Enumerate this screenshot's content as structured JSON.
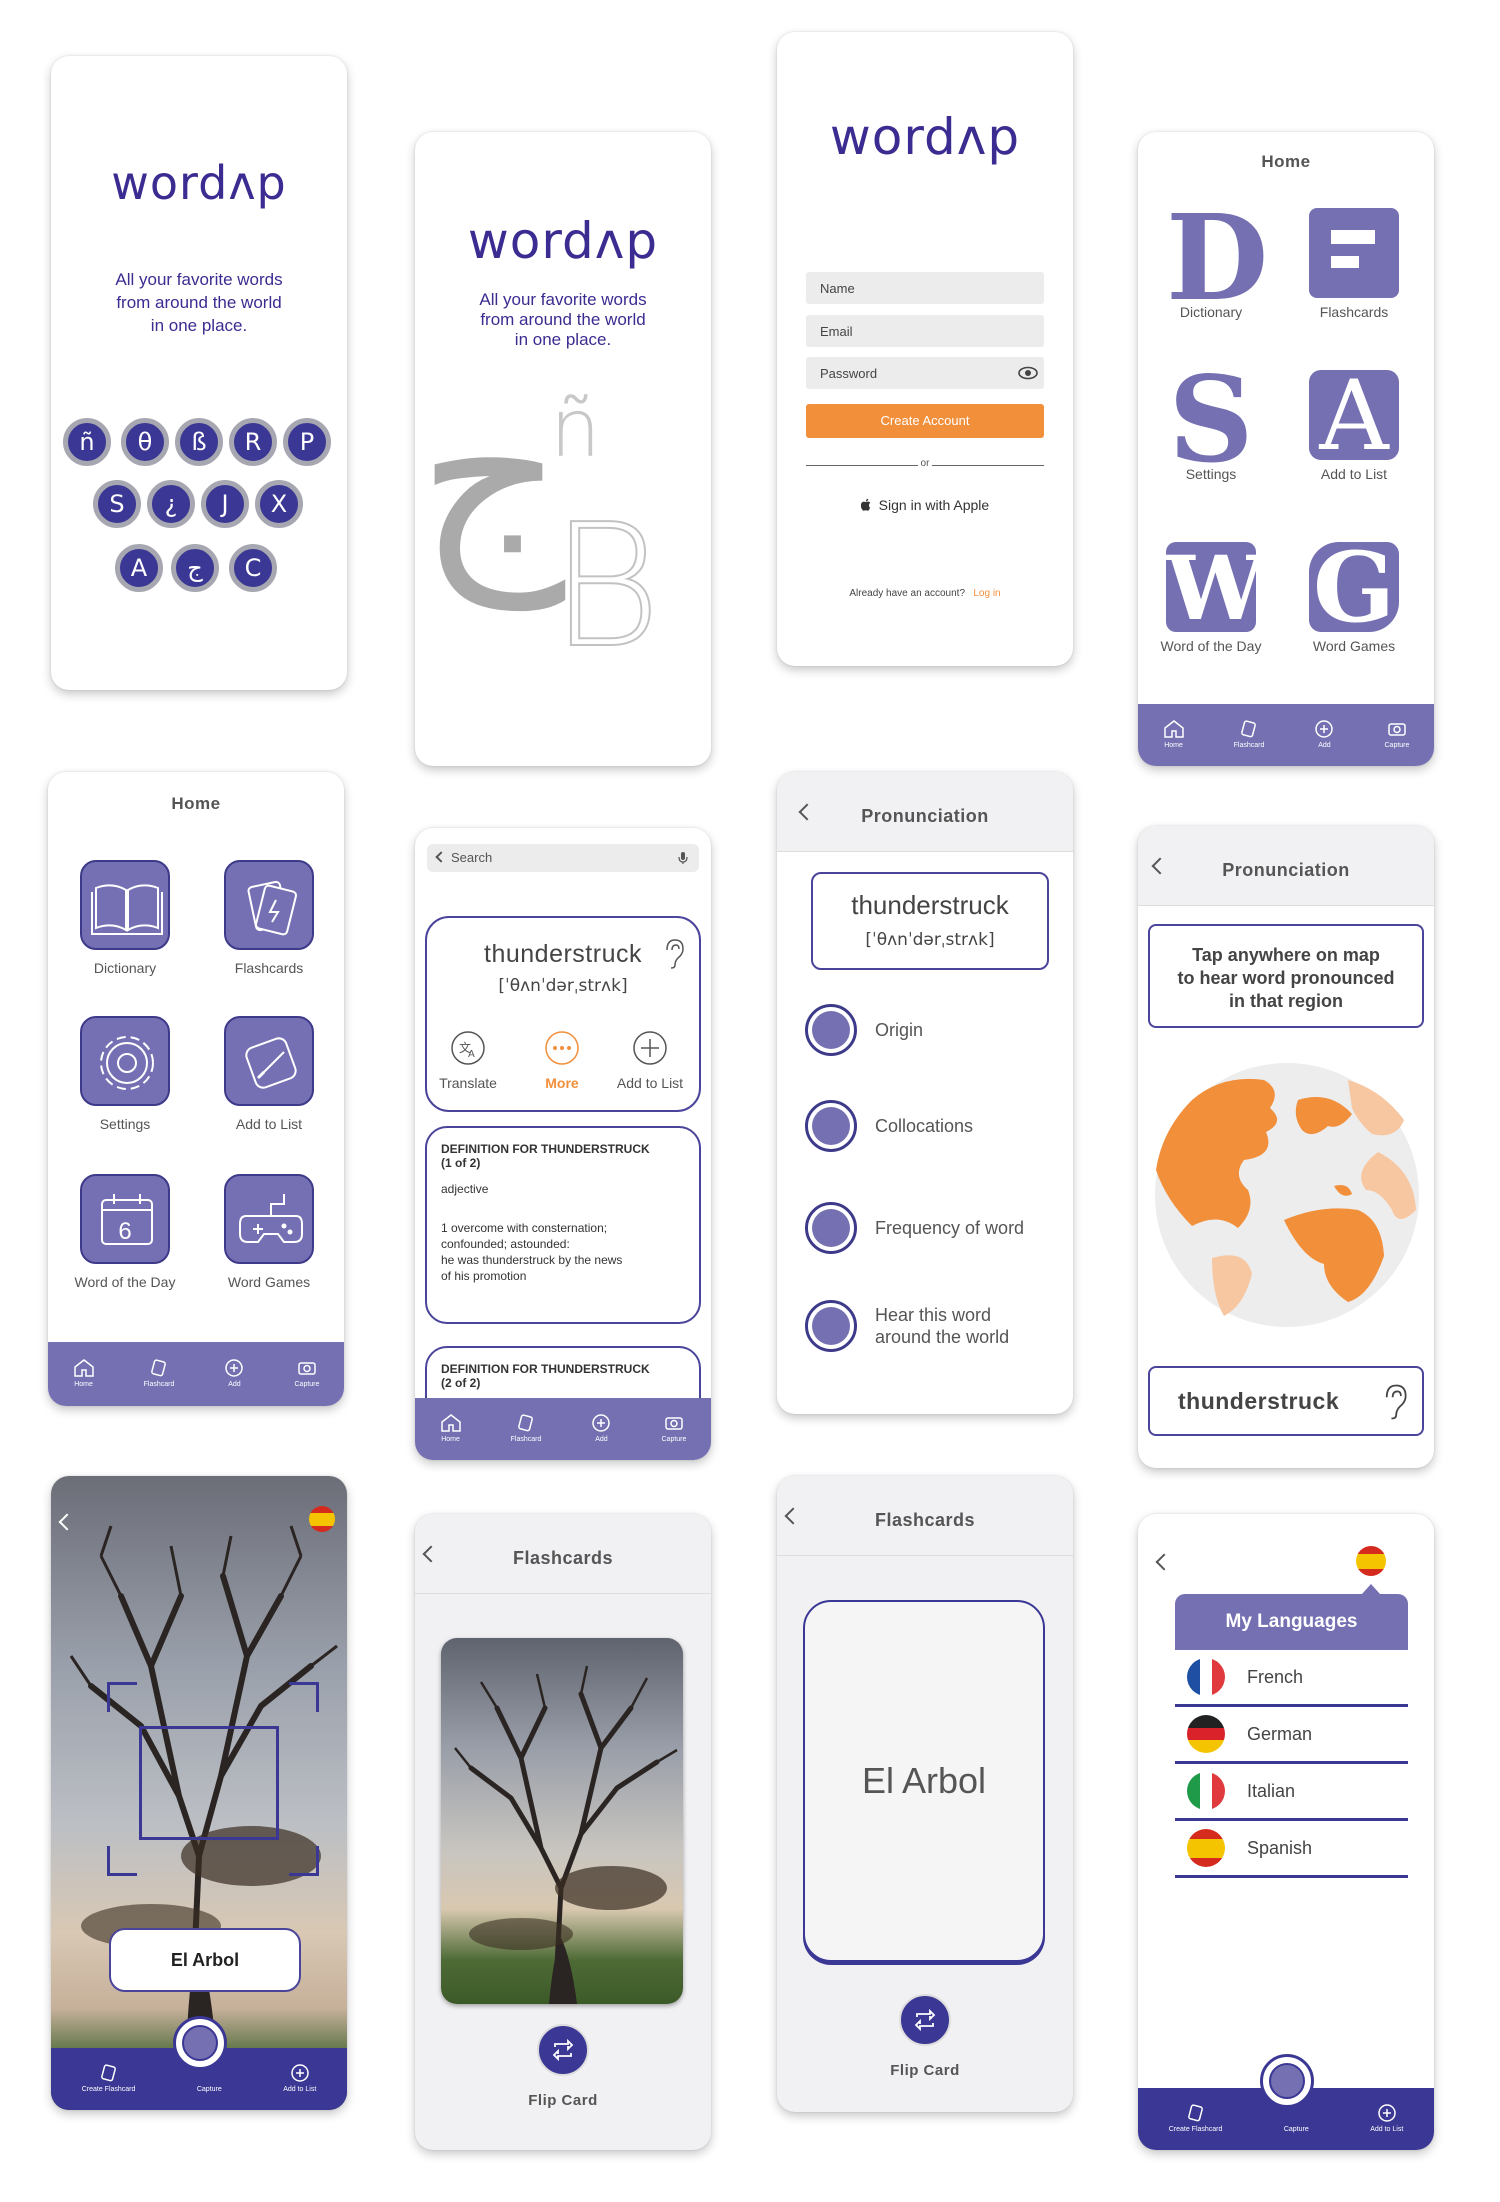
{
  "splash1": {
    "logo": "wordʌp",
    "tagline": [
      "All your favorite words",
      "from around the world",
      "in one place."
    ],
    "letters": [
      "ñ",
      "θ",
      "ß",
      "R",
      "P",
      "S",
      "¿",
      "J",
      "X",
      "A",
      "ج",
      "C"
    ]
  },
  "splash2": {
    "logo": "wordʌp",
    "tagline": [
      "All your favorite words",
      "from around the world",
      "in one place."
    ],
    "glyphs": [
      "ñ",
      "ج",
      "B"
    ]
  },
  "signup": {
    "logo": "wordʌp",
    "name_placeholder": "Name",
    "email_placeholder": "Email",
    "password_placeholder": "Password",
    "create_account": "Create Account",
    "or": "or",
    "apple_signin": "Sign in with Apple",
    "have_account": "Already have an account?",
    "login": "Log in"
  },
  "home_letters": {
    "title": "Home",
    "tiles": [
      {
        "letter": "D",
        "label": "Dictionary"
      },
      {
        "letter": "F",
        "label": "Flashcards"
      },
      {
        "letter": "S",
        "label": "Settings"
      },
      {
        "letter": "A",
        "label": "Add to List"
      },
      {
        "letter": "W",
        "label": "Word of the Day"
      },
      {
        "letter": "G",
        "label": "Word Games"
      }
    ]
  },
  "tabbar": {
    "home": "Home",
    "flashcard": "Flashcard",
    "add": "Add",
    "capture": "Capture"
  },
  "home_icons": {
    "title": "Home",
    "tiles": [
      "Dictionary",
      "Flashcards",
      "Settings",
      "Add to List",
      "Word of the Day",
      "Word Games"
    ],
    "calendar_day": "6"
  },
  "dictionary": {
    "search_placeholder": "Search",
    "word": "thunderstruck",
    "ipa": "[ˈθʌnˈdərˌstrʌk]",
    "actions": [
      "Translate",
      "More",
      "Add to List"
    ],
    "def1_title": "DEFINITION FOR THUNDERSTRUCK",
    "def1_count": "(1 of 2)",
    "pos": "adjective",
    "def1_text": [
      "1 overcome with consternation;",
      "confounded; astounded:",
      "he was thunderstruck by the news",
      "of his promotion"
    ],
    "def2_title": "DEFINITION FOR THUNDERSTRUCK",
    "def2_count": "(2 of 2)"
  },
  "pronunciation1": {
    "title": "Pronunciation",
    "word": "thunderstruck",
    "ipa": "[ˈθʌnˈdərˌstrʌk]",
    "options": [
      "Origin",
      "Collocations",
      "Frequency of word"
    ],
    "option4": [
      "Hear this word",
      "around the world"
    ]
  },
  "pronunciation2": {
    "title": "Pronunciation",
    "instruction": [
      "Tap anywhere on map",
      "to hear word pronounced",
      "in that region"
    ],
    "word": "thunderstruck"
  },
  "capture": {
    "label": "El Arbol",
    "tabs": {
      "create": "Create Flashcard",
      "capture": "Capture",
      "add": "Add to List"
    }
  },
  "flash_photo": {
    "title": "Flashcards",
    "flip": "Flip Card"
  },
  "flash_text": {
    "title": "Flashcards",
    "card_text": "El Arbol",
    "flip": "Flip Card"
  },
  "languages": {
    "title": "My Languages",
    "languages": [
      "French",
      "German",
      "Italian",
      "Spanish"
    ],
    "tabs": {
      "create": "Create Flashcard",
      "capture": "Capture",
      "add": "Add to List"
    }
  },
  "colors": {
    "brand": "#3b2c91",
    "accent": "#f28f3b",
    "tile": "#7470b2"
  }
}
